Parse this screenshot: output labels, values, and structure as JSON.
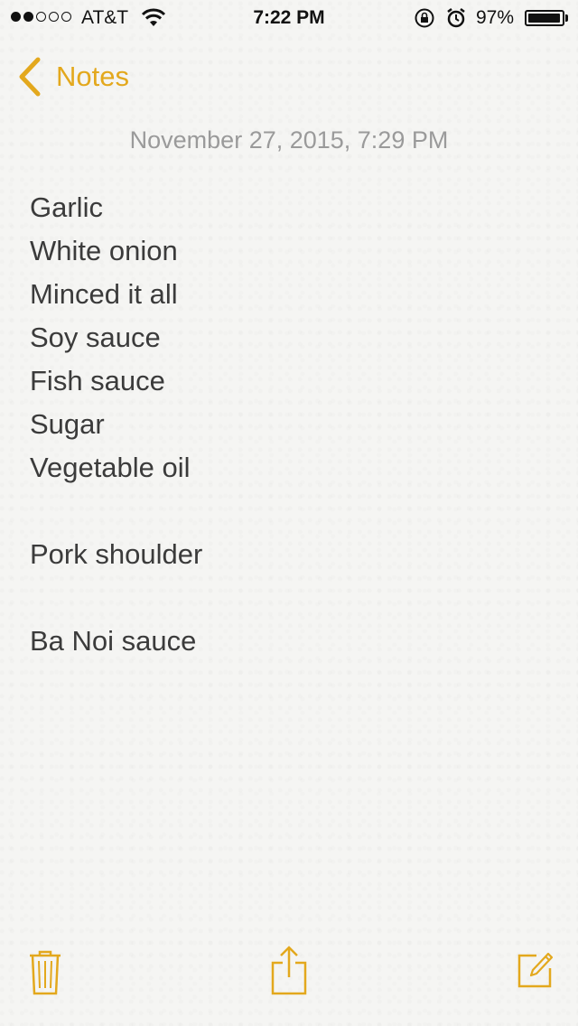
{
  "status_bar": {
    "carrier": "AT&T",
    "time": "7:22 PM",
    "battery_percent": "97%",
    "signal_bars_filled": 2,
    "signal_bars_total": 5,
    "battery_level": 0.97
  },
  "nav": {
    "back_label": "Notes"
  },
  "note": {
    "date": "November 27, 2015, 7:29 PM",
    "lines": [
      "Garlic",
      "White onion",
      "Minced it all",
      "Soy sauce",
      "Fish sauce",
      "Sugar",
      "Vegetable oil",
      "",
      "Pork shoulder",
      "",
      "Ba Noi sauce"
    ]
  },
  "toolbar": {
    "icons": [
      "trash-icon",
      "share-icon",
      "compose-icon"
    ]
  },
  "colors": {
    "accent": "#e3a81d",
    "text": "#3b3b3b",
    "date_text": "#9a9a9a",
    "background": "#f5f5f3"
  }
}
